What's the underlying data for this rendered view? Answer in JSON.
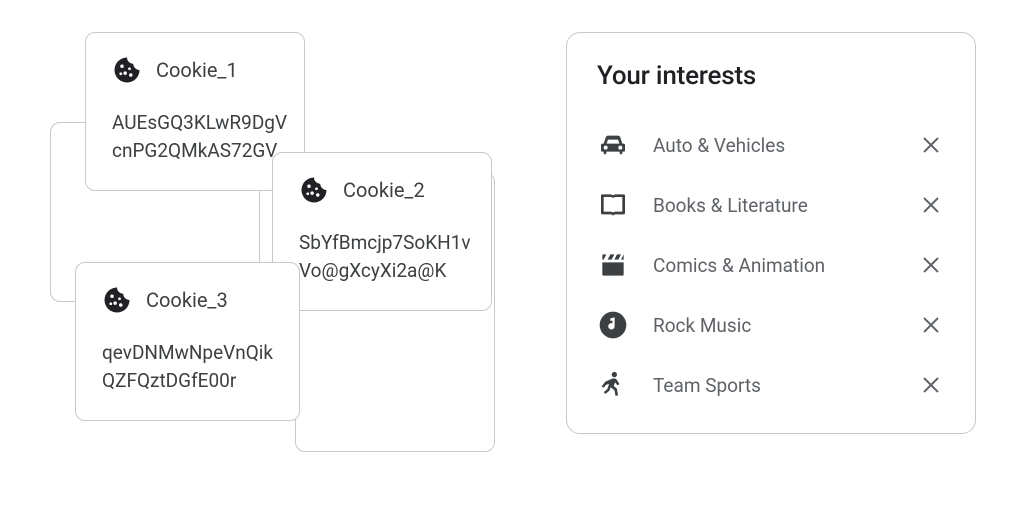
{
  "cookies": [
    {
      "name": "Cookie_1",
      "value_l1": "AUEsGQ3KLwR9DgV",
      "value_l2": "cnPG2QMkAS72GV"
    },
    {
      "name": "Cookie_2",
      "value_l1": "SbYfBmcjp7SoKH1v",
      "value_l2": "Vo@gXcyXi2a@K"
    },
    {
      "name": "Cookie_3",
      "value_l1": "qevDNMwNpeVnQik",
      "value_l2": "QZFQztDGfE00r"
    }
  ],
  "interests": {
    "title": "Your interests",
    "items": [
      {
        "label": "Auto & Vehicles",
        "icon": "car-icon"
      },
      {
        "label": "Books & Literature",
        "icon": "book-icon"
      },
      {
        "label": "Comics & Animation",
        "icon": "clapper-icon"
      },
      {
        "label": "Rock Music",
        "icon": "music-note-icon"
      },
      {
        "label": "Team Sports",
        "icon": "sports-icon"
      }
    ]
  }
}
